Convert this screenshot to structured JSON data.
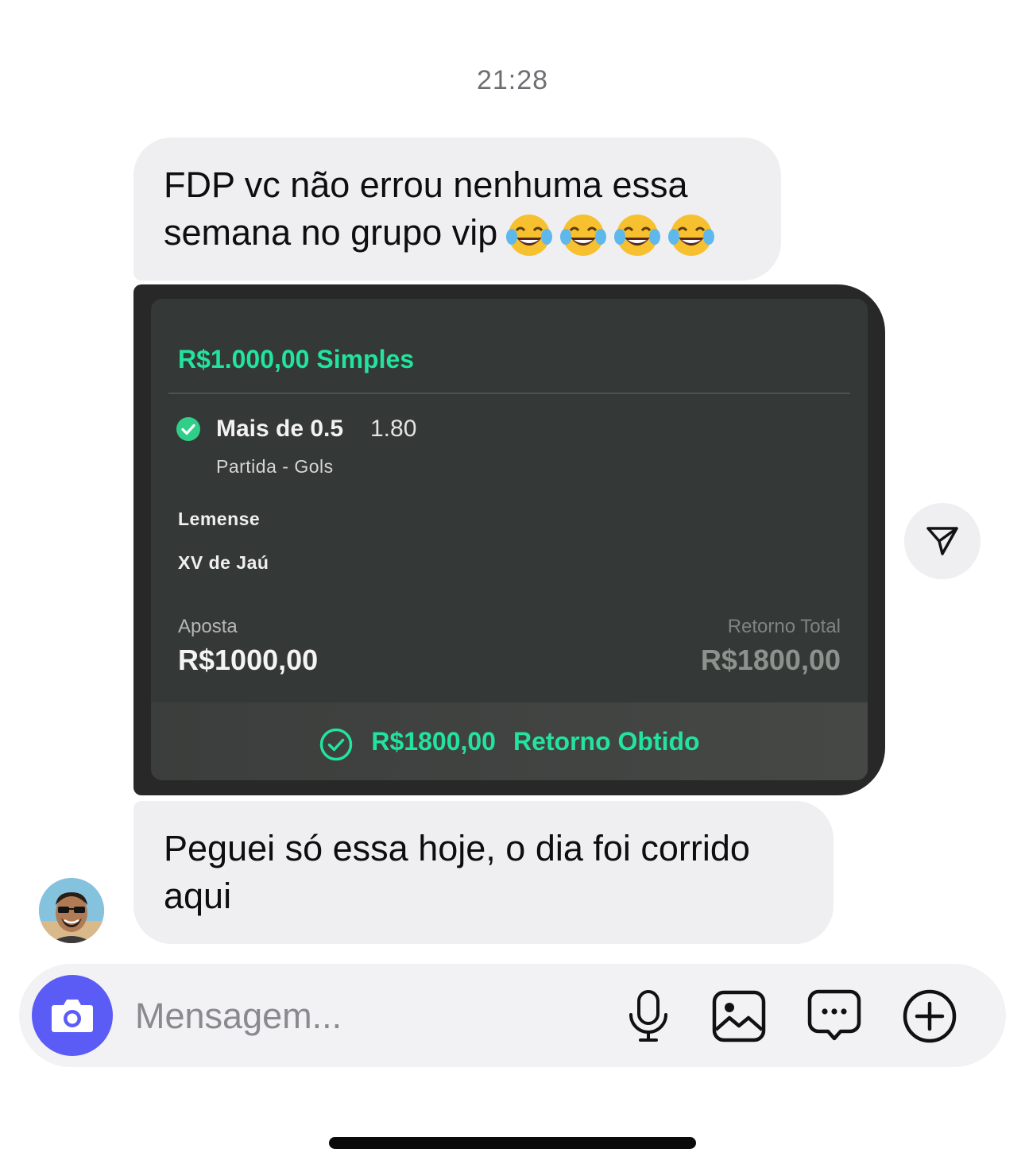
{
  "chat": {
    "timestamp": "21:28",
    "messages": [
      {
        "text": "FDP vc não errou nenhuma essa semana no grupo vip",
        "line1": "FDP vc não errou nenhuma essa",
        "line2": "semana no grupo vip",
        "emoji": [
          "face-with-tears-of-joy",
          "face-with-tears-of-joy",
          "face-with-tears-of-joy",
          "face-with-tears-of-joy"
        ]
      },
      {
        "type": "bet-slip",
        "title": "R$1.000,00 Simples",
        "selection": "Mais de 0.5",
        "odds": "1.80",
        "market": "Partida - Gols",
        "team_home": "Lemense",
        "team_away": "XV de Jaú",
        "stake_label": "Aposta",
        "stake_value": "R$1000,00",
        "return_label": "Retorno Total",
        "return_value": "R$1800,00",
        "footer_amount": "R$1800,00",
        "footer_label": "Retorno Obtido"
      },
      {
        "line1": "Peguei só essa hoje, o dia foi corrido",
        "line2": "aqui"
      }
    ]
  },
  "composer": {
    "placeholder": "Mensagem...",
    "icons": [
      "camera-icon",
      "microphone-icon",
      "gallery-icon",
      "sticker-icon",
      "plus-icon"
    ]
  },
  "colors": {
    "accent_green": "#22e39f",
    "camera_button": "#5b5cf6",
    "bubble_gray": "#efeff1",
    "bet_dark": "#343836"
  }
}
